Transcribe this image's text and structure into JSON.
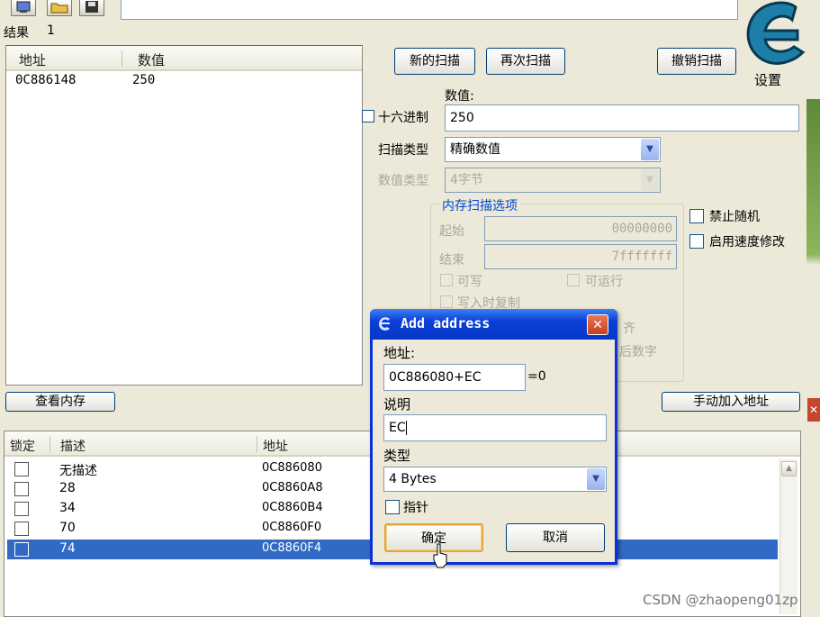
{
  "toolbar": {
    "icons": [
      "process-icon",
      "open-icon",
      "save-icon"
    ]
  },
  "results": {
    "label": "结果",
    "count": "1",
    "columns": {
      "address": "地址",
      "value": "数值"
    },
    "rows": [
      {
        "address": "0C886148",
        "value": "250"
      }
    ]
  },
  "buttons": {
    "new_scan": "新的扫描",
    "next_scan": "再次扫描",
    "undo_scan": "撤销扫描",
    "settings": "设置",
    "view_memory": "查看内存",
    "add_manual": "手动加入地址"
  },
  "scan": {
    "value_label": "数值:",
    "hex_label": "十六进制",
    "value": "250",
    "scan_type_label": "扫描类型",
    "scan_type": "精确数值",
    "value_type_label": "数值类型",
    "value_type": "4字节"
  },
  "memory_options": {
    "title": "内存扫描选项",
    "start_label": "起始",
    "start": "00000000",
    "end_label": "结束",
    "end": "7fffffff",
    "writable": "可写",
    "executable": "可运行",
    "copy_on_write": "写入时复制",
    "partial_align": "齐",
    "partial_last_digits": "后数字"
  },
  "side_options": {
    "no_random": "禁止随机",
    "speedhack": "启用速度修改"
  },
  "address_list": {
    "columns": {
      "lock": "锁定",
      "description": "描述",
      "address": "地址"
    },
    "rows": [
      {
        "description": "无描述",
        "address": "0C886080"
      },
      {
        "description": "28",
        "address": "0C8860A8"
      },
      {
        "description": "34",
        "address": "0C8860B4"
      },
      {
        "description": "70",
        "address": "0C8860F0"
      },
      {
        "description": "74",
        "address": "0C8860F4",
        "selected": true
      }
    ]
  },
  "dialog": {
    "title": "Add address",
    "address_label": "地址:",
    "address_value": "0C886080+EC",
    "address_result": "=0",
    "desc_label": "说明",
    "desc_value": "EC",
    "type_label": "类型",
    "type_value": "4 Bytes",
    "pointer_label": "指针",
    "ok": "确定",
    "cancel": "取消"
  },
  "watermark": "CSDN @zhaopeng01zp",
  "colors": {
    "selection": "#316ac5",
    "title_bar": "#0a3fd6",
    "group_title": "#0046d5"
  }
}
